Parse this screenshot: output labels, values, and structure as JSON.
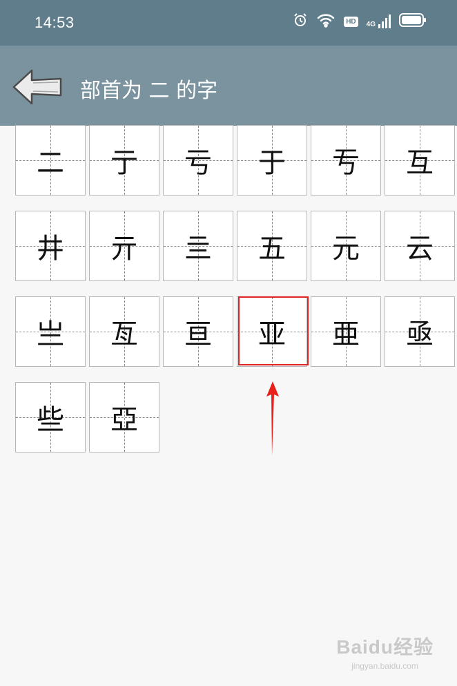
{
  "status_bar": {
    "time": "14:53",
    "icons": [
      "alarm-icon",
      "wifi-icon",
      "hd-icon",
      "signal-4g-icon",
      "battery-icon"
    ],
    "hd_label": "HD",
    "network_label": "4G"
  },
  "header": {
    "title": "部首为 二 的字",
    "back_icon": "back-arrow-icon"
  },
  "characters": [
    "二",
    "亍",
    "亏",
    "于",
    "亐",
    "互",
    "井",
    "亓",
    "亖",
    "五",
    "元",
    "云",
    "亗",
    "亙",
    "亘",
    "亚",
    "亜",
    "亟",
    "些",
    "亞"
  ],
  "highlighted_character": "亚",
  "colors": {
    "status_bar": "#5f7d8b",
    "title_bar": "#7a939e",
    "highlight": "#e02424",
    "background": "#f7f7f7"
  },
  "watermark": {
    "logo": "Baidu经验",
    "url": "jingyan.baidu.com"
  }
}
